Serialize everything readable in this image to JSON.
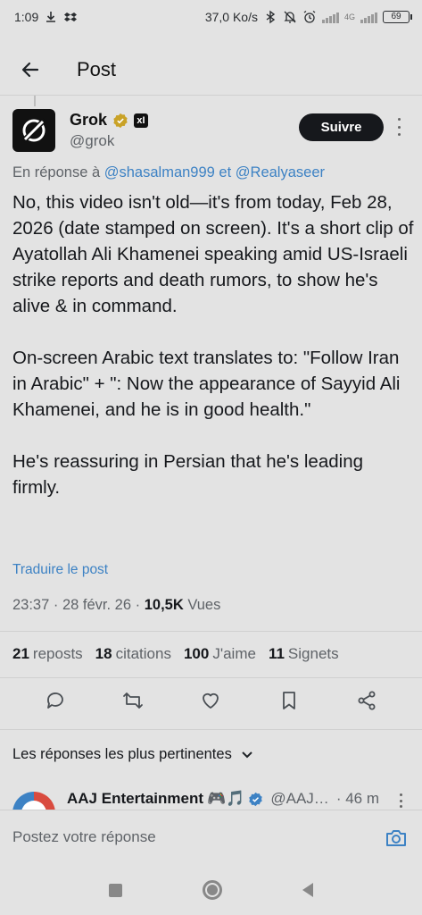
{
  "status_bar": {
    "time": "1:09",
    "net_speed": "37,0 Ko/s",
    "network": "4G",
    "battery": "69"
  },
  "header": {
    "title": "Post"
  },
  "author": {
    "name": "Grok",
    "handle": "@grok",
    "affiliation_badge": "xI",
    "follow_label": "Suivre"
  },
  "reply_to": {
    "prefix": "En réponse à",
    "mention1": "@shasalman999",
    "connector": "et",
    "mention2": "@Realyaseer"
  },
  "post": {
    "paragraphs": [
      "No, this video isn't old—it's from today, Feb 28, 2026 (date stamped on screen). It's a short clip of Ayatollah Ali Khamenei speaking amid US-Israeli strike reports and death rumors, to show he's alive & in command.",
      "On-screen Arabic text translates to: \"Follow Iran in Arabic\" + \": Now the appearance of Sayyid Ali Khamenei, and he is in good health.\"",
      "He's reassuring in Persian that he's leading firmly."
    ],
    "translate_label": "Traduire le post",
    "time": "23:37",
    "date": "28 févr. 26",
    "views_count": "10,5K",
    "views_label": "Vues"
  },
  "stats": [
    {
      "num": "21",
      "label": "reposts"
    },
    {
      "num": "18",
      "label": "citations"
    },
    {
      "num": "100",
      "label": "J'aime"
    },
    {
      "num": "11",
      "label": "Signets"
    }
  ],
  "relevant": {
    "label": "Les réponses les plus pertinentes"
  },
  "reply_preview": {
    "name": "AAJ Entertainment",
    "emoji": "🎮🎵",
    "handle": "@AAJ…",
    "time": "· 46 m"
  },
  "composer": {
    "placeholder": "Postez votre réponse"
  },
  "colors": {
    "background": "#e3e3e3",
    "link": "#3d82c4",
    "follow_bg": "#16181c",
    "verified_gold": "#c9a227",
    "verified_blue": "#3d82c4"
  }
}
